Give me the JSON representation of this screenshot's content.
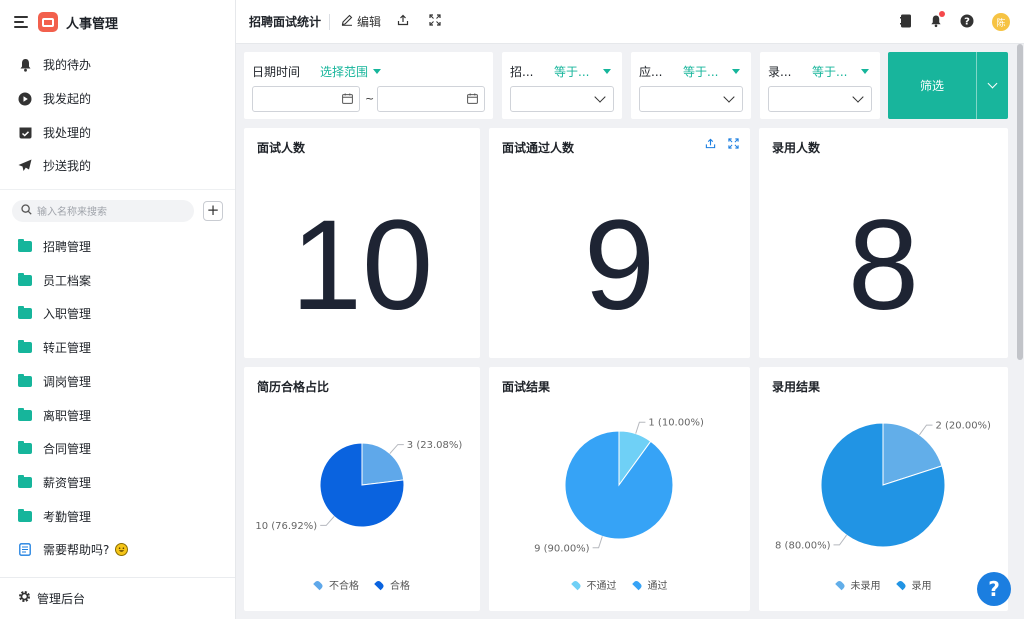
{
  "sidebar": {
    "app_title": "人事管理",
    "quick_items": [
      {
        "label": "我的待办",
        "icon": "bell-icon"
      },
      {
        "label": "我发起的",
        "icon": "play-circle-icon"
      },
      {
        "label": "我处理的",
        "icon": "check-box-icon"
      },
      {
        "label": "抄送我的",
        "icon": "send-icon"
      }
    ],
    "search_placeholder": "输入名称来搜索",
    "folders": [
      {
        "label": "招聘管理"
      },
      {
        "label": "员工档案"
      },
      {
        "label": "入职管理"
      },
      {
        "label": "转正管理"
      },
      {
        "label": "调岗管理"
      },
      {
        "label": "离职管理"
      },
      {
        "label": "合同管理"
      },
      {
        "label": "薪资管理"
      },
      {
        "label": "考勤管理"
      }
    ],
    "help_label": "需要帮助吗?",
    "footer_label": "管理后台"
  },
  "topbar": {
    "page_title": "招聘面试统计",
    "edit_label": "编辑",
    "avatar_text": "陈"
  },
  "filters": {
    "date": {
      "label": "日期时间",
      "operator": "选择范围"
    },
    "f1": {
      "label": "招...",
      "operator": "等于..."
    },
    "f2": {
      "label": "应...",
      "operator": "等于..."
    },
    "f3": {
      "label": "录...",
      "operator": "等于..."
    },
    "filter_button": "筛选"
  },
  "metrics": [
    {
      "title": "面试人数",
      "value": "10"
    },
    {
      "title": "面试通过人数",
      "value": "9"
    },
    {
      "title": "录用人数",
      "value": "8"
    }
  ],
  "chart_data": [
    {
      "type": "pie",
      "title": "简历合格占比",
      "categories": [
        "不合格",
        "合格"
      ],
      "values": [
        3,
        10
      ],
      "labels": [
        "3 (23.08%)",
        "10 (76.92%)"
      ],
      "colors": [
        "#5fa8ea",
        "#0a63df"
      ]
    },
    {
      "type": "pie",
      "title": "面试结果",
      "categories": [
        "不通过",
        "通过"
      ],
      "values": [
        1,
        9
      ],
      "labels": [
        "1 (10.00%)",
        "9 (90.00%)"
      ],
      "colors": [
        "#6fd0f6",
        "#36a3f6"
      ]
    },
    {
      "type": "pie",
      "title": "录用结果",
      "categories": [
        "未录用",
        "录用"
      ],
      "values": [
        2,
        8
      ],
      "labels": [
        "2 (20.00%)",
        "8 (80.00%)"
      ],
      "colors": [
        "#62aee9",
        "#2194e4"
      ]
    }
  ]
}
